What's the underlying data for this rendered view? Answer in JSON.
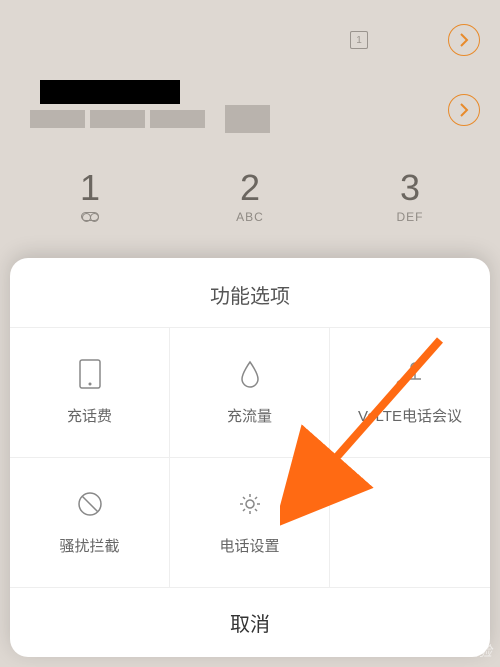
{
  "calls": [
    {
      "label": ""
    },
    {
      "label": ""
    }
  ],
  "keypad": [
    {
      "num": "1",
      "sub": ""
    },
    {
      "num": "2",
      "sub": "ABC"
    },
    {
      "num": "3",
      "sub": "DEF"
    }
  ],
  "sheet": {
    "title": "功能选项",
    "cells": [
      {
        "label": "充话费",
        "icon": "phone-card"
      },
      {
        "label": "充流量",
        "icon": "droplet"
      },
      {
        "label": "VoLTE电话会议",
        "icon": "mic-people"
      },
      {
        "label": "骚扰拦截",
        "icon": "block"
      },
      {
        "label": "电话设置",
        "icon": "gear"
      }
    ],
    "cancel": "取消"
  },
  "watermark": "Bai du 经验"
}
